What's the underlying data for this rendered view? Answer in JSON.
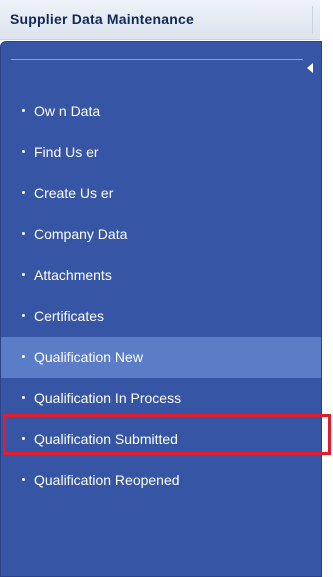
{
  "header": {
    "title": "Supplier Data Maintenance"
  },
  "panel": {
    "collapse_icon": "chevron-left-icon"
  },
  "nav": {
    "items": [
      {
        "label": "Ow n Data"
      },
      {
        "label": "Find Us er"
      },
      {
        "label": "Create Us er"
      },
      {
        "label": "Company Data"
      },
      {
        "label": "Attachments"
      },
      {
        "label": "Certificates"
      },
      {
        "label": "Qualification New"
      },
      {
        "label": "Qualification In Process"
      },
      {
        "label": "Qualification Submitted"
      },
      {
        "label": "Qualification Reopened"
      }
    ],
    "active_index": 6,
    "highlighted_index": 7
  },
  "colors": {
    "panel_bg": "#3655a4",
    "active_bg": "#5b7cc7",
    "highlight_border": "#e21b2d",
    "header_text": "#0f2a55"
  }
}
